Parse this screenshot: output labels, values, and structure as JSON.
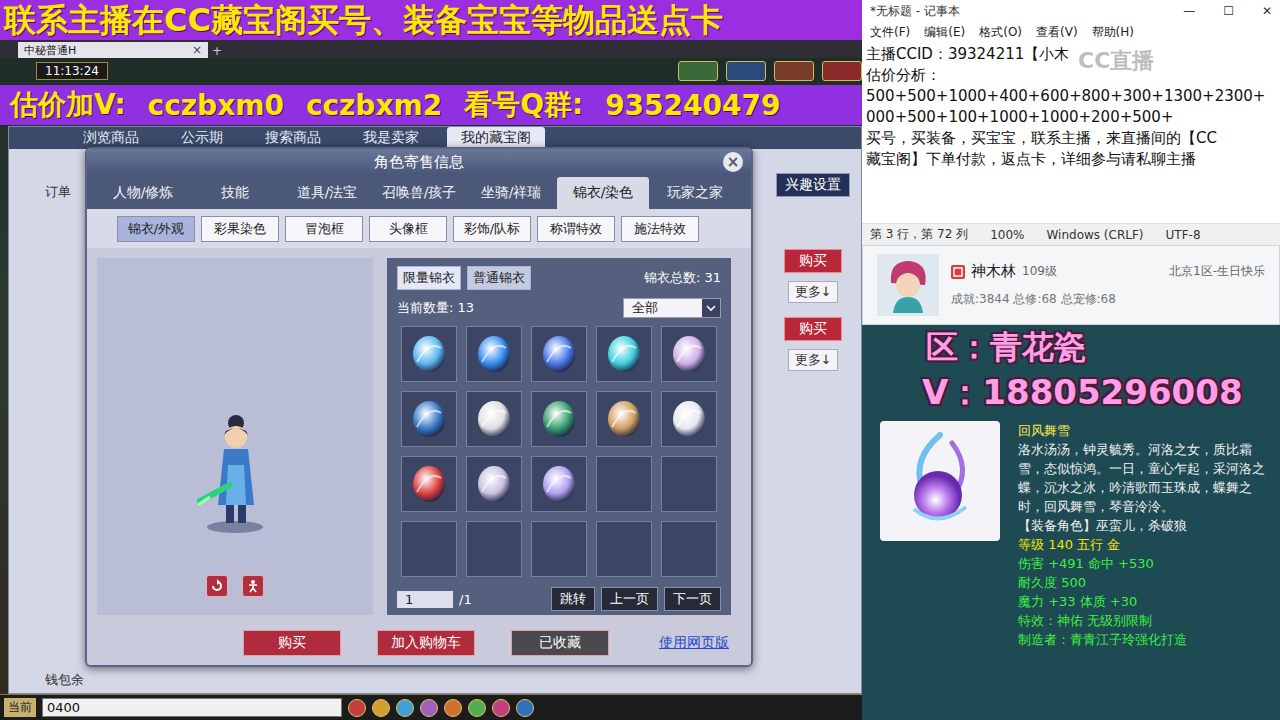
{
  "stream_banner": {
    "text": "联系主播在CC藏宝阁买号、装备宝宝等物品送点卡"
  },
  "browser_tab": {
    "title": "中秘普通H",
    "close": "×",
    "add": "+"
  },
  "hud": {
    "time": "11:13:24"
  },
  "price_banner": {
    "segments": [
      "估价加V:",
      "cczbxm0",
      "cczbxm2",
      "看号Q群:",
      "935240479"
    ]
  },
  "cbg": {
    "tabs": [
      {
        "label": "浏览商品",
        "selected": false
      },
      {
        "label": "公示期",
        "selected": false
      },
      {
        "label": "搜索商品",
        "selected": false
      },
      {
        "label": "我是卖家",
        "selected": false
      },
      {
        "label": "我的藏宝阁",
        "selected": true
      }
    ],
    "side_label": "订单",
    "wallet_label": "钱包余",
    "interest_button": "兴趣设置",
    "listings": [
      {
        "buy": "购买",
        "more": "更多↓"
      },
      {
        "buy": "购买",
        "more": "更多↓"
      }
    ]
  },
  "dialog": {
    "title": "角色寄售信息",
    "close": "×",
    "tabs": [
      {
        "label": "人物/修炼",
        "selected": false
      },
      {
        "label": "技能",
        "selected": false
      },
      {
        "label": "道具/法宝",
        "selected": false
      },
      {
        "label": "召唤兽/孩子",
        "selected": false
      },
      {
        "label": "坐骑/祥瑞",
        "selected": false
      },
      {
        "label": "锦衣/染色",
        "selected": true
      },
      {
        "label": "玩家之家",
        "selected": false
      }
    ],
    "subtabs": [
      {
        "label": "锦衣/外观",
        "selected": true
      },
      {
        "label": "彩果染色",
        "selected": false
      },
      {
        "label": "冒泡框",
        "selected": false
      },
      {
        "label": "头像框",
        "selected": false
      },
      {
        "label": "彩饰/队标",
        "selected": false
      },
      {
        "label": "称谓特效",
        "selected": false
      },
      {
        "label": "施法特效",
        "selected": false
      }
    ],
    "filters": [
      {
        "label": "限量锦衣",
        "selected": true
      },
      {
        "label": "普通锦衣",
        "selected": false
      }
    ],
    "total_label": "锦衣总数:",
    "total": "31",
    "count_label": "当前数量:",
    "count": "13",
    "category": "全部",
    "items": [
      {
        "color": "#5ab8f0"
      },
      {
        "color": "#3a8ef0"
      },
      {
        "color": "#4a7ae8"
      },
      {
        "color": "#40d0e0"
      },
      {
        "color": "#d0b0e8"
      },
      {
        "color": "#3a7ac8"
      },
      {
        "color": "#e0e0e0"
      },
      {
        "color": "#3aa070"
      },
      {
        "color": "#d0a060"
      },
      {
        "color": "#e8e8f0"
      },
      {
        "color": "#e04040"
      },
      {
        "color": "#c8c0e0"
      },
      {
        "color": "#b0a0f0"
      }
    ],
    "page": "1",
    "page_total": "/1",
    "pager": [
      "跳转",
      "上一页",
      "下一页"
    ],
    "footer": [
      {
        "label": "购买",
        "kind": "primary"
      },
      {
        "label": "加入购物车",
        "kind": "primary"
      },
      {
        "label": "已收藏",
        "kind": "muted"
      },
      {
        "label": "使用网页版",
        "kind": "link"
      }
    ]
  },
  "chat_bar": {
    "channel": "当前",
    "input": "0400"
  },
  "notepad": {
    "title": "*无标题 - 记事本",
    "controls": [
      "—",
      "☐",
      "✕"
    ],
    "menu": [
      "文件(F)",
      "编辑(E)",
      "格式(O)",
      "查看(V)",
      "帮助(H)"
    ],
    "lines": [
      "主播CCID：39324211【小木",
      "估价分析：",
      "500+500+1000+400+600+800+300+1300+2300+",
      "000+500+100+1000+1000+200+500+",
      "买号，买装备，买宝宝，联系主播，来直播间的【CC",
      "藏宝阁】下单付款，返点卡，详细参与请私聊主播"
    ],
    "watermark": "CC直播",
    "status": [
      "第 3 行，第 72 列",
      "100%",
      "Windows (CRLF)",
      "UTF-8"
    ]
  },
  "streamer": {
    "name": "神木林",
    "level": "109级",
    "server": "北京1区-生日快乐",
    "stats": "成就:3844 总修:68 总宠修:68"
  },
  "server_overlay": {
    "region": "区：青花瓷",
    "contact": "V：18805296008"
  },
  "item_tooltip": {
    "name": "回风舞雪",
    "description": "洛水汤汤，钟灵毓秀。河洛之女，质比霜雪，态似惊鸿。一日，童心乍起，采河洛之蝶，沉水之冰，吟清歌而玉珠成，蝶舞之时，回风舞雪，琴音泠泠。",
    "role": "【装备角色】巫蛮儿，杀破狼",
    "stats": [
      {
        "text": "等级 140 五行 金",
        "color": "#f2e600"
      },
      {
        "text": "伤害 +491 命中 +530",
        "color": "#3cf03c"
      },
      {
        "text": "耐久度 500",
        "color": "#3cf03c"
      },
      {
        "text": "魔力 +33 体质 +30",
        "color": "#3cf03c"
      },
      {
        "text": "特效：神佑 无级别限制",
        "color": "#3cf03c"
      },
      {
        "text": "制造者：青青江子玲强化打造",
        "color": "#3cf03c"
      }
    ]
  }
}
